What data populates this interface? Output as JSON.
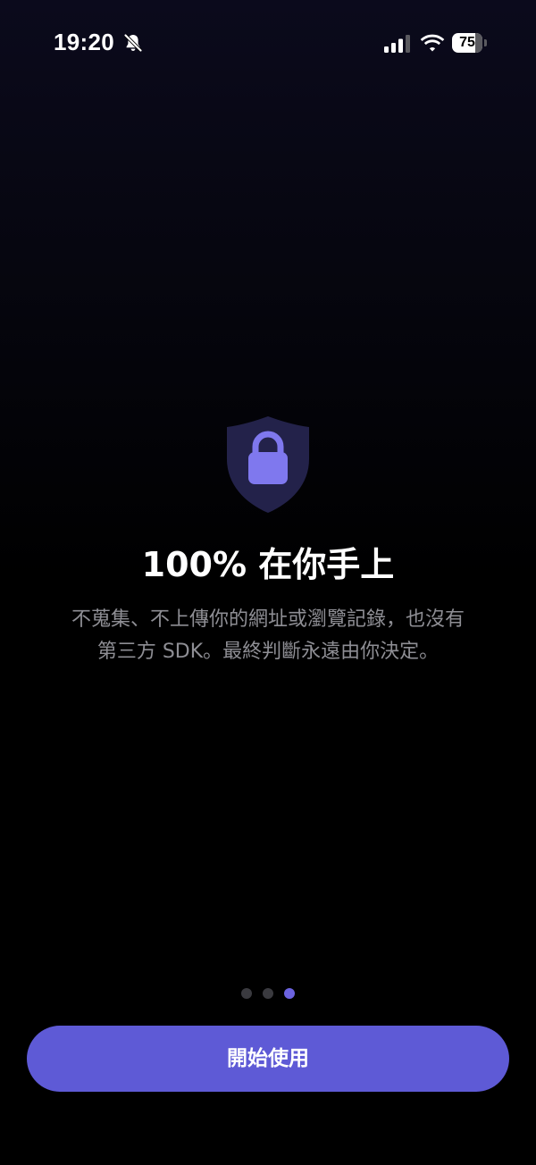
{
  "status_bar": {
    "time": "19:20",
    "battery_level": "75",
    "battery_fraction": 0.75
  },
  "icons": {
    "status_bell": "bell-slash-icon",
    "signal": "cellular-signal-icon",
    "wifi": "wifi-icon",
    "hero": "shield-lock-icon"
  },
  "onboarding": {
    "title": "100% 在你手上",
    "description_lines": [
      "不蒐集、不上傳你的網址或瀏覽記錄，也沒有",
      "第三方 SDK。最終判斷永遠由你決定。"
    ],
    "page_count": 3,
    "current_page": 3
  },
  "cta": {
    "label": "開始使用"
  },
  "colors": {
    "accent": "#5e5ad6",
    "active_dot": "#6c63e0",
    "inactive_dot": "#3a3a3f",
    "description_text": "#8e8e94",
    "shield_fill": "#23224a",
    "lock_fill": "#7f78ee"
  }
}
